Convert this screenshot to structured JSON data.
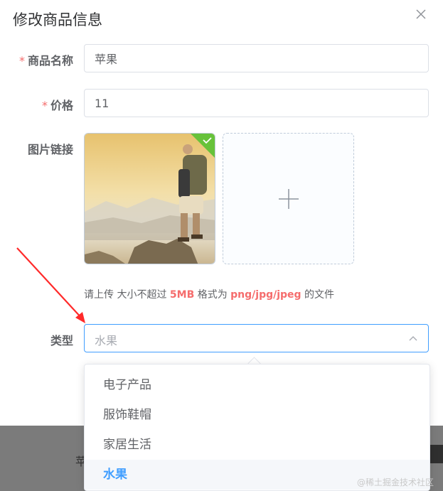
{
  "dialog": {
    "title": "修改商品信息"
  },
  "form": {
    "required_mark": "*",
    "name": {
      "label": "商品名称",
      "value": "苹果"
    },
    "price": {
      "label": "价格",
      "value": "11"
    },
    "image": {
      "label": "图片链接",
      "tip_prefix": "请上传 大小不超过",
      "tip_size": "5MB",
      "tip_mid": "格式为",
      "tip_formats": "png/jpg/jpeg",
      "tip_suffix": "的文件"
    },
    "category": {
      "label": "类型",
      "value": "水果",
      "options": [
        "电子产品",
        "服饰鞋帽",
        "家居生活",
        "水果"
      ],
      "selected_index": 3
    }
  },
  "backdrop": {
    "partial_text": "苹"
  },
  "watermark": "@稀土掘金技术社区",
  "colors": {
    "required": "#f56c6c",
    "accent": "#409eff",
    "success": "#67c23a"
  }
}
